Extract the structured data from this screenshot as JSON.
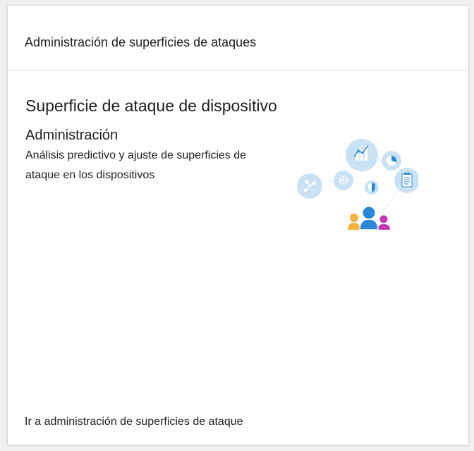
{
  "card": {
    "header_title": "Administración de superficies de ataques",
    "section_title": "Superficie de ataque de dispositivo",
    "subtitle": "Administración",
    "description": "Análisis predictivo y ajuste de superficies de ataque en los dispositivos",
    "footer_link": "Ir a administración de superficies de ataque"
  },
  "illustration": {
    "icons": [
      "network-icon",
      "gear-icon",
      "bar-chart-icon",
      "shield-icon",
      "pie-chart-icon",
      "document-icon",
      "people-icon"
    ]
  },
  "colors": {
    "bubble": "#c9e2f5",
    "icon_blue": "#2b88d8",
    "person_orange": "#f3b33d",
    "person_blue": "#2b88d8",
    "person_pink": "#c239b3"
  }
}
